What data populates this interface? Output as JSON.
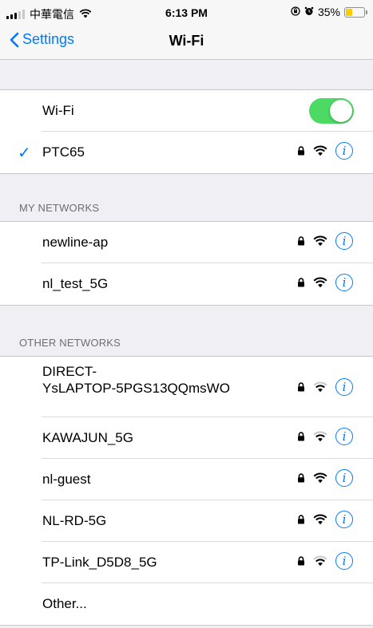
{
  "status_bar": {
    "carrier": "中華電信",
    "time": "6:13 PM",
    "battery_pct": "35%"
  },
  "nav": {
    "back_label": "Settings",
    "title": "Wi-Fi"
  },
  "wifi_toggle": {
    "label": "Wi-Fi",
    "on": true
  },
  "connected": {
    "check": "✓",
    "name": "PTC65"
  },
  "my_networks": {
    "header": "MY NETWORKS",
    "items": [
      {
        "name": "newline-ap"
      },
      {
        "name": "nl_test_5G"
      }
    ]
  },
  "other_networks": {
    "header": "OTHER NETWORKS",
    "items": [
      {
        "name_line1": "DIRECT-",
        "name_line2": "YsLAPTOP-5PGS13QQmsWO"
      },
      {
        "name": "KAWAJUN_5G"
      },
      {
        "name": "nl-guest"
      },
      {
        "name": "NL-RD-5G"
      },
      {
        "name": "TP-Link_D5D8_5G"
      }
    ],
    "other_label": "Other..."
  },
  "info_glyph": "i",
  "colors": {
    "accent": "#007aff",
    "toggle_on": "#4cd964",
    "battery": "#ffcc00"
  }
}
